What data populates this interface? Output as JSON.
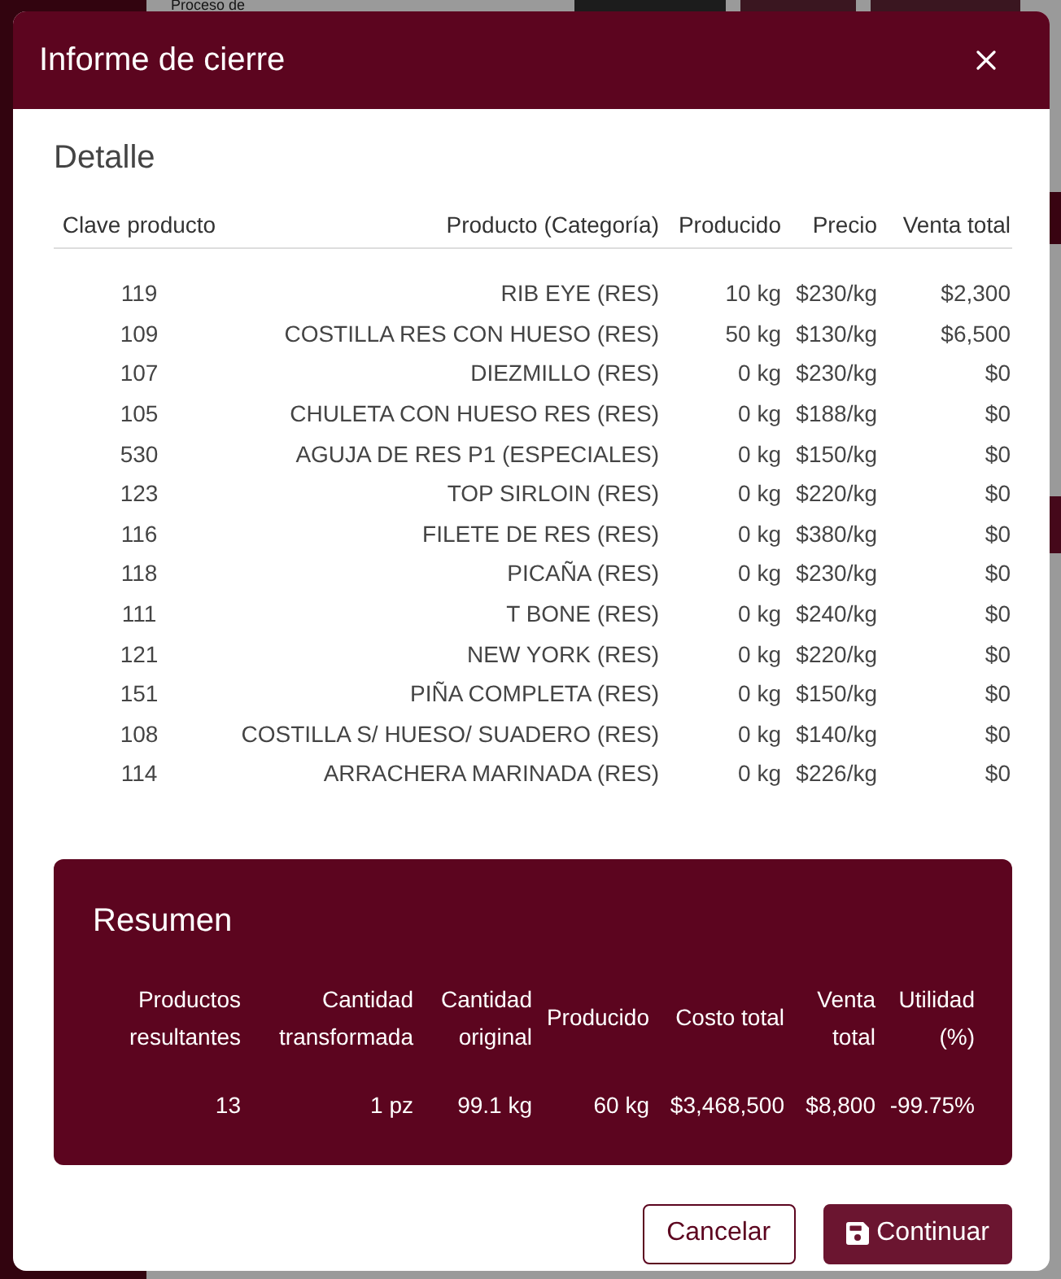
{
  "background": {
    "heading": "Proceso de"
  },
  "dialog": {
    "title": "Informe de cierre"
  },
  "detail": {
    "title": "Detalle",
    "columns": [
      "Clave producto",
      "Producto (Categoría)",
      "Producido",
      "Precio",
      "Venta total"
    ],
    "rows": [
      [
        "119",
        "RIB EYE (RES)",
        "10 kg",
        "$230/kg",
        "$2,300"
      ],
      [
        "109",
        "COSTILLA RES CON HUESO (RES)",
        "50 kg",
        "$130/kg",
        "$6,500"
      ],
      [
        "107",
        "DIEZMILLO (RES)",
        "0 kg",
        "$230/kg",
        "$0"
      ],
      [
        "105",
        "CHULETA CON HUESO RES (RES)",
        "0 kg",
        "$188/kg",
        "$0"
      ],
      [
        "530",
        "AGUJA DE RES P1 (ESPECIALES)",
        "0 kg",
        "$150/kg",
        "$0"
      ],
      [
        "123",
        "TOP SIRLOIN (RES)",
        "0 kg",
        "$220/kg",
        "$0"
      ],
      [
        "116",
        "FILETE DE RES (RES)",
        "0 kg",
        "$380/kg",
        "$0"
      ],
      [
        "118",
        "PICAÑA (RES)",
        "0 kg",
        "$230/kg",
        "$0"
      ],
      [
        "111",
        "T BONE (RES)",
        "0 kg",
        "$240/kg",
        "$0"
      ],
      [
        "121",
        "NEW YORK (RES)",
        "0 kg",
        "$220/kg",
        "$0"
      ],
      [
        "151",
        "PIÑA COMPLETA (RES)",
        "0 kg",
        "$150/kg",
        "$0"
      ],
      [
        "108",
        "COSTILLA S/ HUESO/ SUADERO (RES)",
        "0 kg",
        "$140/kg",
        "$0"
      ],
      [
        "114",
        "ARRACHERA MARINADA (RES)",
        "0 kg",
        "$226/kg",
        "$0"
      ]
    ]
  },
  "summary": {
    "title": "Resumen",
    "columns": [
      "Productos resultantes",
      "Cantidad transformada",
      "Cantidad original",
      "Producido",
      "Costo total",
      "Venta total",
      "Utilidad (%)"
    ],
    "values": [
      "13",
      "1 pz",
      "99.1 kg",
      "60 kg",
      "$3,468,500",
      "$8,800",
      "-99.75%"
    ]
  },
  "buttons": [
    {
      "label": "Cancelar",
      "kind": "secondary"
    },
    {
      "label": "Continuar",
      "kind": "primary"
    }
  ]
}
